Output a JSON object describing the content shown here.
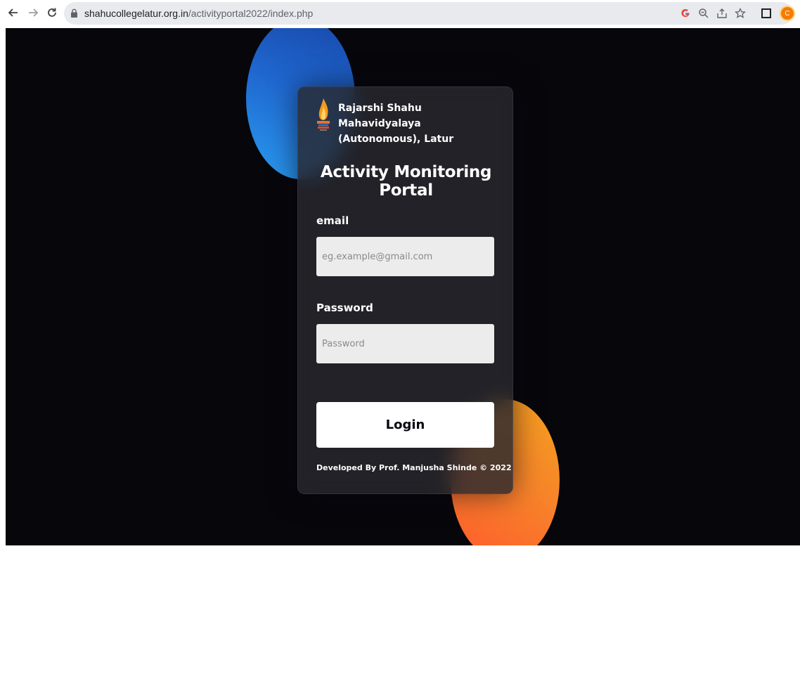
{
  "browser": {
    "url_host": "shahucollegelatur.org.in",
    "url_path": "/activityportal2022/index.php",
    "profile_initial": "C",
    "icons": [
      "back-icon",
      "forward-icon",
      "reload-icon",
      "lock-icon",
      "google-icon",
      "zoom-icon",
      "share-icon",
      "bookmark-star-icon",
      "side-panel-icon",
      "profile-avatar"
    ]
  },
  "login": {
    "college_name_line1": "Rajarshi Shahu Mahavidyalaya",
    "college_name_line2": "(Autonomous), Latur",
    "portal_title": "Activity Monitoring Portal",
    "email_label": "email",
    "email_placeholder": "eg.example@gmail.com",
    "password_label": "Password",
    "password_placeholder": "Password",
    "login_button": "Login",
    "footer": "Developed By Prof. Manjusha Shinde © 2022"
  },
  "colors": {
    "background": "#07060b",
    "card": "#28282e",
    "blue_shape": "#1f67cf",
    "orange_shape": "#f7822a",
    "input": "#ececec",
    "button": "#ffffff"
  }
}
